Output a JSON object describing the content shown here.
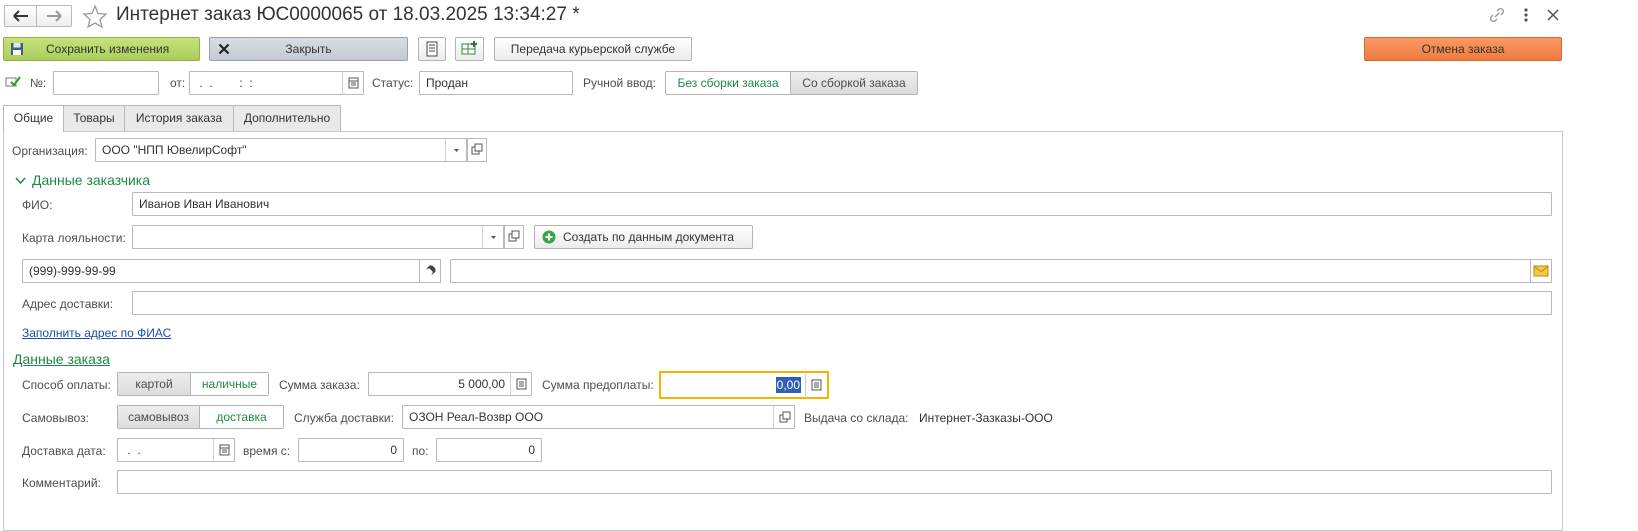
{
  "window": {
    "title": "Интернет заказ ЮС0000065 от 18.03.2025 13:34:27 *"
  },
  "toolbar": {
    "save_label": "Сохранить изменения",
    "close_label": "Закрыть",
    "courier_label": "Передача курьерской службе",
    "cancel_label": "Отмена заказа"
  },
  "header": {
    "number_label": "№:",
    "number_value": "",
    "from_label": "от:",
    "date_value": " .  .        :  :",
    "status_label": "Статус:",
    "status_value": "Продан",
    "manual_label": "Ручной ввод:",
    "manual_options": [
      "Без сборки заказа",
      "Со сборкой заказа"
    ],
    "manual_selected": "Без сборки заказа"
  },
  "tabs": [
    {
      "label": "Общие",
      "active": true
    },
    {
      "label": "Товары",
      "active": false
    },
    {
      "label": "История заказа",
      "active": false
    },
    {
      "label": "Дополнительно",
      "active": false
    }
  ],
  "general": {
    "org_label": "Организация:",
    "org_value": "ООО \"НПП ЮвелирСофт\"",
    "customer_section": "Данные заказчика",
    "fio_label": "ФИО:",
    "fio_value": "Иванов Иван Иванович",
    "loyalty_label": "Карта лояльности:",
    "loyalty_value": "",
    "create_btn": "Создать по данным документа",
    "phone_value": "(999)-999-99-99",
    "email_value": "",
    "address_label": "Адрес доставки:",
    "address_value": "",
    "fias_link": "Заполнить адрес по ФИАС"
  },
  "order": {
    "section": "Данные заказа",
    "payment_label": "Способ оплаты:",
    "payment_options": [
      "картой",
      "наличные"
    ],
    "payment_selected": "наличные",
    "sum_label": "Сумма заказа:",
    "sum_value": "5 000,00",
    "prepay_label": "Сумма предоплаты:",
    "prepay_value": "0,00",
    "pickup_label": "Самовывоз:",
    "pickup_options": [
      "самовывоз",
      "доставка"
    ],
    "pickup_selected": "доставка",
    "delivery_service_label": "Служба доставки:",
    "delivery_service_value": "ОЗОН Реал-Возвр ООО",
    "warehouse_label": "Выдача со склада:",
    "warehouse_value": "Интернет-Зазказы-ООО",
    "delivery_date_label": "Доставка дата:",
    "delivery_date_value": " .  .",
    "time_from_label": "время с:",
    "time_from_value": "0",
    "time_to_label": "по:",
    "time_to_value": "0",
    "comment_label": "Комментарий:",
    "comment_value": ""
  },
  "colors": {
    "accent_green": "#1e8a43",
    "save_bg": "#b5d86a",
    "cancel_bg": "#f4884f",
    "focus_border": "#f5b400"
  }
}
